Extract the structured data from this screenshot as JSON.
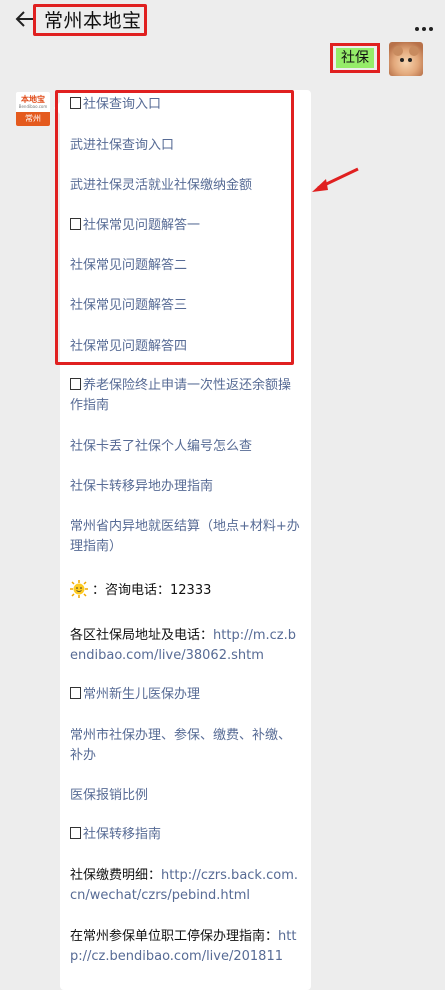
{
  "header": {
    "title": "常州本地宝"
  },
  "user_message": {
    "text": "社保"
  },
  "bot_avatar": {
    "top": "本地宝",
    "sub": "Bendibao.com",
    "bottom": "常州"
  },
  "items": [
    {
      "prefix_box": true,
      "text": "社保查询入口"
    },
    {
      "prefix_box": false,
      "text": "武进社保查询入口"
    },
    {
      "prefix_box": false,
      "text": "武进社保灵活就业社保缴纳金额"
    },
    {
      "prefix_box": true,
      "text": "社保常见问题解答一"
    },
    {
      "prefix_box": false,
      "text": "社保常见问题解答二"
    },
    {
      "prefix_box": false,
      "text": "社保常见问题解答三"
    },
    {
      "prefix_box": false,
      "text": "社保常见问题解答四"
    },
    {
      "prefix_box": true,
      "text": "养老保险终止申请一次性返还余额操作指南"
    },
    {
      "prefix_box": false,
      "text": "社保卡丢了社保个人编号怎么查"
    },
    {
      "prefix_box": false,
      "text": "社保卡转移异地办理指南"
    },
    {
      "prefix_box": false,
      "text": "常州省内异地就医结算（地点+材料+办理指南）"
    },
    {
      "prefix_box": true,
      "text": "常州新生儿医保办理"
    },
    {
      "prefix_box": false,
      "text": "常州市社保办理、参保、缴费、补缴、补办"
    },
    {
      "prefix_box": false,
      "text": "医保报销比例"
    },
    {
      "prefix_box": true,
      "text": "社保转移指南"
    }
  ],
  "phone": {
    "label": "：咨询电话：12333"
  },
  "address": {
    "label": "各区社保局地址及电话：",
    "url": "http://m.cz.bendibao.com/live/38062.shtm"
  },
  "payment_detail": {
    "label": "社保缴费明细：",
    "url": "http://czrs.back.com.cn/wechat/czrs/pebind.html"
  },
  "unemployment": {
    "label": "在常州参保单位职工停保办理指南：",
    "url": "http://cz.bendibao.com/live/201811"
  }
}
